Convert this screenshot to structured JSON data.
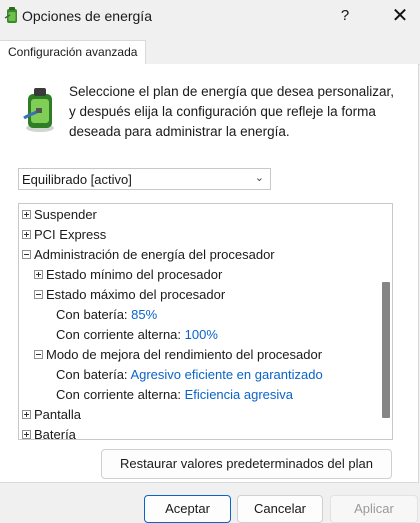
{
  "window": {
    "title": "Opciones de energía",
    "help_glyph": "?",
    "close_glyph": "✕"
  },
  "tabs": [
    {
      "label": "Configuración avanzada",
      "active": true
    }
  ],
  "intro_text": "Seleccione el plan de energía que desea personalizar, y después elija la configuración que refleje la forma deseada para administrar la energía.",
  "plan_select": {
    "value": "Equilibrado [activo]",
    "arrow": "⌄"
  },
  "tree": {
    "items": [
      {
        "label": "Suspender",
        "expander": "plus",
        "value": ""
      },
      {
        "label": "PCI Express",
        "expander": "plus",
        "value": ""
      },
      {
        "label": "Administración de energía del procesador",
        "expander": "minus",
        "value": ""
      },
      {
        "label": "Estado mínimo del procesador",
        "expander": "plus",
        "value": ""
      },
      {
        "label": "Estado máximo del procesador",
        "expander": "minus",
        "value": ""
      },
      {
        "label": "Con batería:",
        "expander": "",
        "value": "85%"
      },
      {
        "label": "Con corriente alterna:",
        "expander": "",
        "value": "100%"
      },
      {
        "label": "Modo de mejora del rendimiento del procesador",
        "expander": "minus",
        "value": ""
      },
      {
        "label": "Con batería:",
        "expander": "",
        "value": "Agresivo eficiente en garantizado"
      },
      {
        "label": "Con corriente alterna:",
        "expander": "",
        "value": "Eficiencia agresiva"
      },
      {
        "label": "Pantalla",
        "expander": "plus",
        "value": ""
      },
      {
        "label": "Batería",
        "expander": "plus",
        "value": ""
      }
    ]
  },
  "buttons": {
    "restore": "Restaurar valores predeterminados del plan",
    "accept": "Aceptar",
    "cancel": "Cancelar",
    "apply": "Aplicar"
  },
  "colors": {
    "value_link": "#0a64c8",
    "accent_border": "#0a64c8",
    "scroll_thumb": "#858585"
  }
}
